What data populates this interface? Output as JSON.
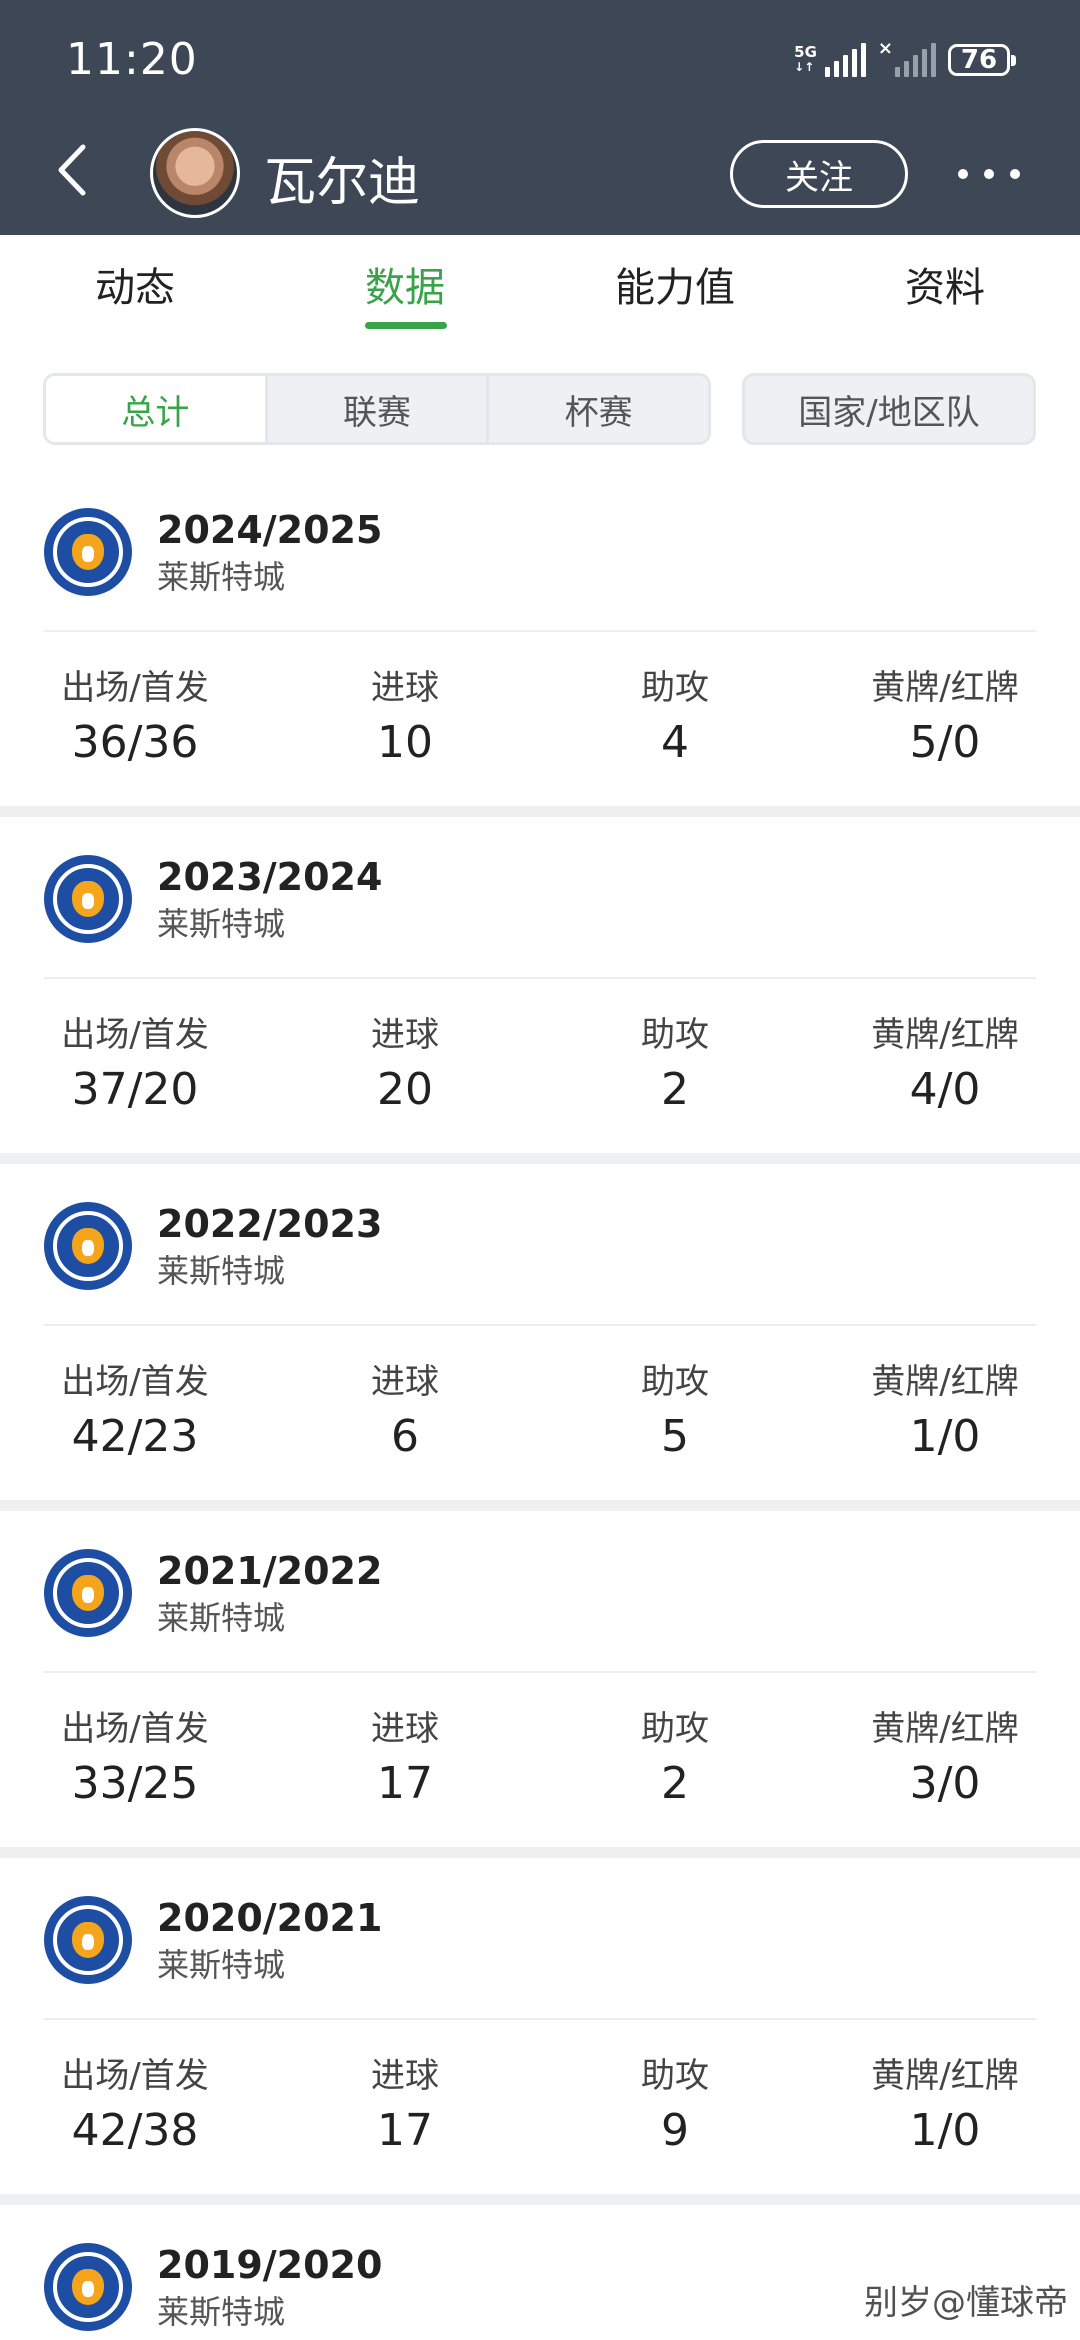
{
  "status_bar": {
    "time": "11:20",
    "network": "5G",
    "battery": "76"
  },
  "header": {
    "player_name": "瓦尔迪",
    "follow_label": "关注"
  },
  "main_tabs": [
    "动态",
    "数据",
    "能力值",
    "资料"
  ],
  "sub_tabs": [
    "总计",
    "联赛",
    "杯赛"
  ],
  "region_tab": "国家/地区队",
  "stat_labels": {
    "apps": "出场/首发",
    "goals": "进球",
    "assists": "助攻",
    "cards": "黄牌/红牌"
  },
  "seasons": [
    {
      "year": "2024/2025",
      "club": "莱斯特城",
      "apps": "36/36",
      "goals": "10",
      "assists": "4",
      "cards": "5/0"
    },
    {
      "year": "2023/2024",
      "club": "莱斯特城",
      "apps": "37/20",
      "goals": "20",
      "assists": "2",
      "cards": "4/0"
    },
    {
      "year": "2022/2023",
      "club": "莱斯特城",
      "apps": "42/23",
      "goals": "6",
      "assists": "5",
      "cards": "1/0"
    },
    {
      "year": "2021/2022",
      "club": "莱斯特城",
      "apps": "33/25",
      "goals": "17",
      "assists": "2",
      "cards": "3/0"
    },
    {
      "year": "2020/2021",
      "club": "莱斯特城",
      "apps": "42/38",
      "goals": "17",
      "assists": "9",
      "cards": "1/0"
    },
    {
      "year": "2019/2020",
      "club": "莱斯特城"
    }
  ],
  "watermark": "别岁@懂球帝",
  "colors": {
    "header_bg": "#3e4756",
    "accent_green": "#3aa34a",
    "club_blue": "#1d4ea3"
  }
}
